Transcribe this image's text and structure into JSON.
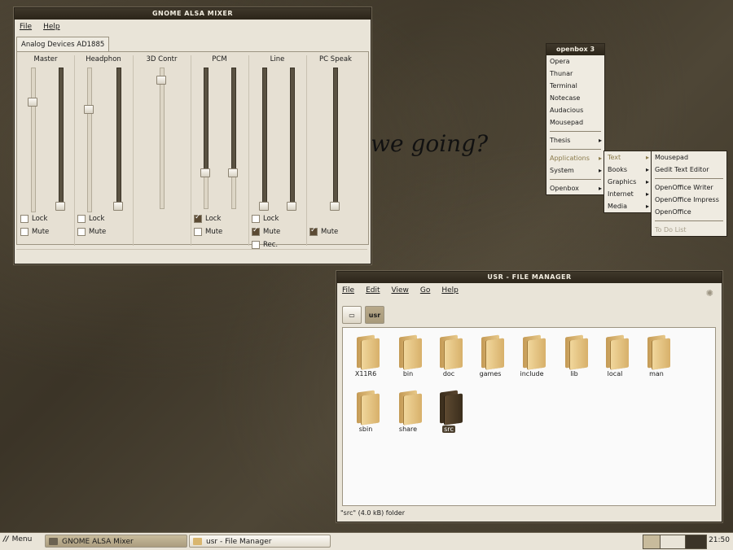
{
  "wallpaper_text": "we going?",
  "mixer": {
    "title": "GNOME ALSA MIXER",
    "menu": [
      "File",
      "Help"
    ],
    "device_tab": "Analog Devices AD1885",
    "channels": [
      {
        "name": "Master",
        "levels": [
          0.77,
          0.03
        ],
        "lock": false,
        "mute": false
      },
      {
        "name": "Headphon",
        "levels": [
          0.73,
          0.03
        ],
        "lock": false,
        "mute": false
      },
      {
        "name": "3D Contr",
        "levels": [
          1.0
        ],
        "lock": null,
        "mute": null
      },
      {
        "name": "PCM",
        "levels": [
          0.28,
          0.28
        ],
        "lock": true,
        "mute": false
      },
      {
        "name": "Line",
        "levels": [
          0.03,
          0.03
        ],
        "lock": false,
        "mute": true,
        "rec": false
      },
      {
        "name": "PC Speak",
        "levels": [
          0.03
        ],
        "lock": null,
        "mute": true
      }
    ],
    "lock_label": "Lock",
    "mute_label": "Mute",
    "rec_label": "Rec."
  },
  "openbox": {
    "title": "openbox 3",
    "items": [
      "Opera",
      "Thunar",
      "Terminal",
      "Notecase",
      "Audacious",
      "Mousepad"
    ],
    "thesis": "Thesis",
    "applications": "Applications",
    "system": "System",
    "openbox_item": "Openbox",
    "app_submenu": [
      "Text",
      "Books",
      "Graphics",
      "Internet",
      "Media"
    ],
    "text_submenu": [
      "Mousepad",
      "Gedit Text Editor",
      "OpenOffice Writer",
      "OpenOffice Impress",
      "OpenOffice"
    ],
    "todo": "To Do List"
  },
  "filemanager": {
    "title": "USR - FILE MANAGER",
    "menu": [
      "File",
      "Edit",
      "View",
      "Go",
      "Help"
    ],
    "path_button": "usr",
    "folders": [
      "X11R6",
      "bin",
      "doc",
      "games",
      "include",
      "lib",
      "local",
      "man",
      "sbin",
      "share",
      "src"
    ],
    "selected": "src",
    "status": "\"src\" (4.0 kB) folder"
  },
  "taskbar": {
    "menu_label": "Menu",
    "tasks": [
      "GNOME ALSA Mixer",
      "usr - File Manager"
    ],
    "clock": "21:50"
  }
}
